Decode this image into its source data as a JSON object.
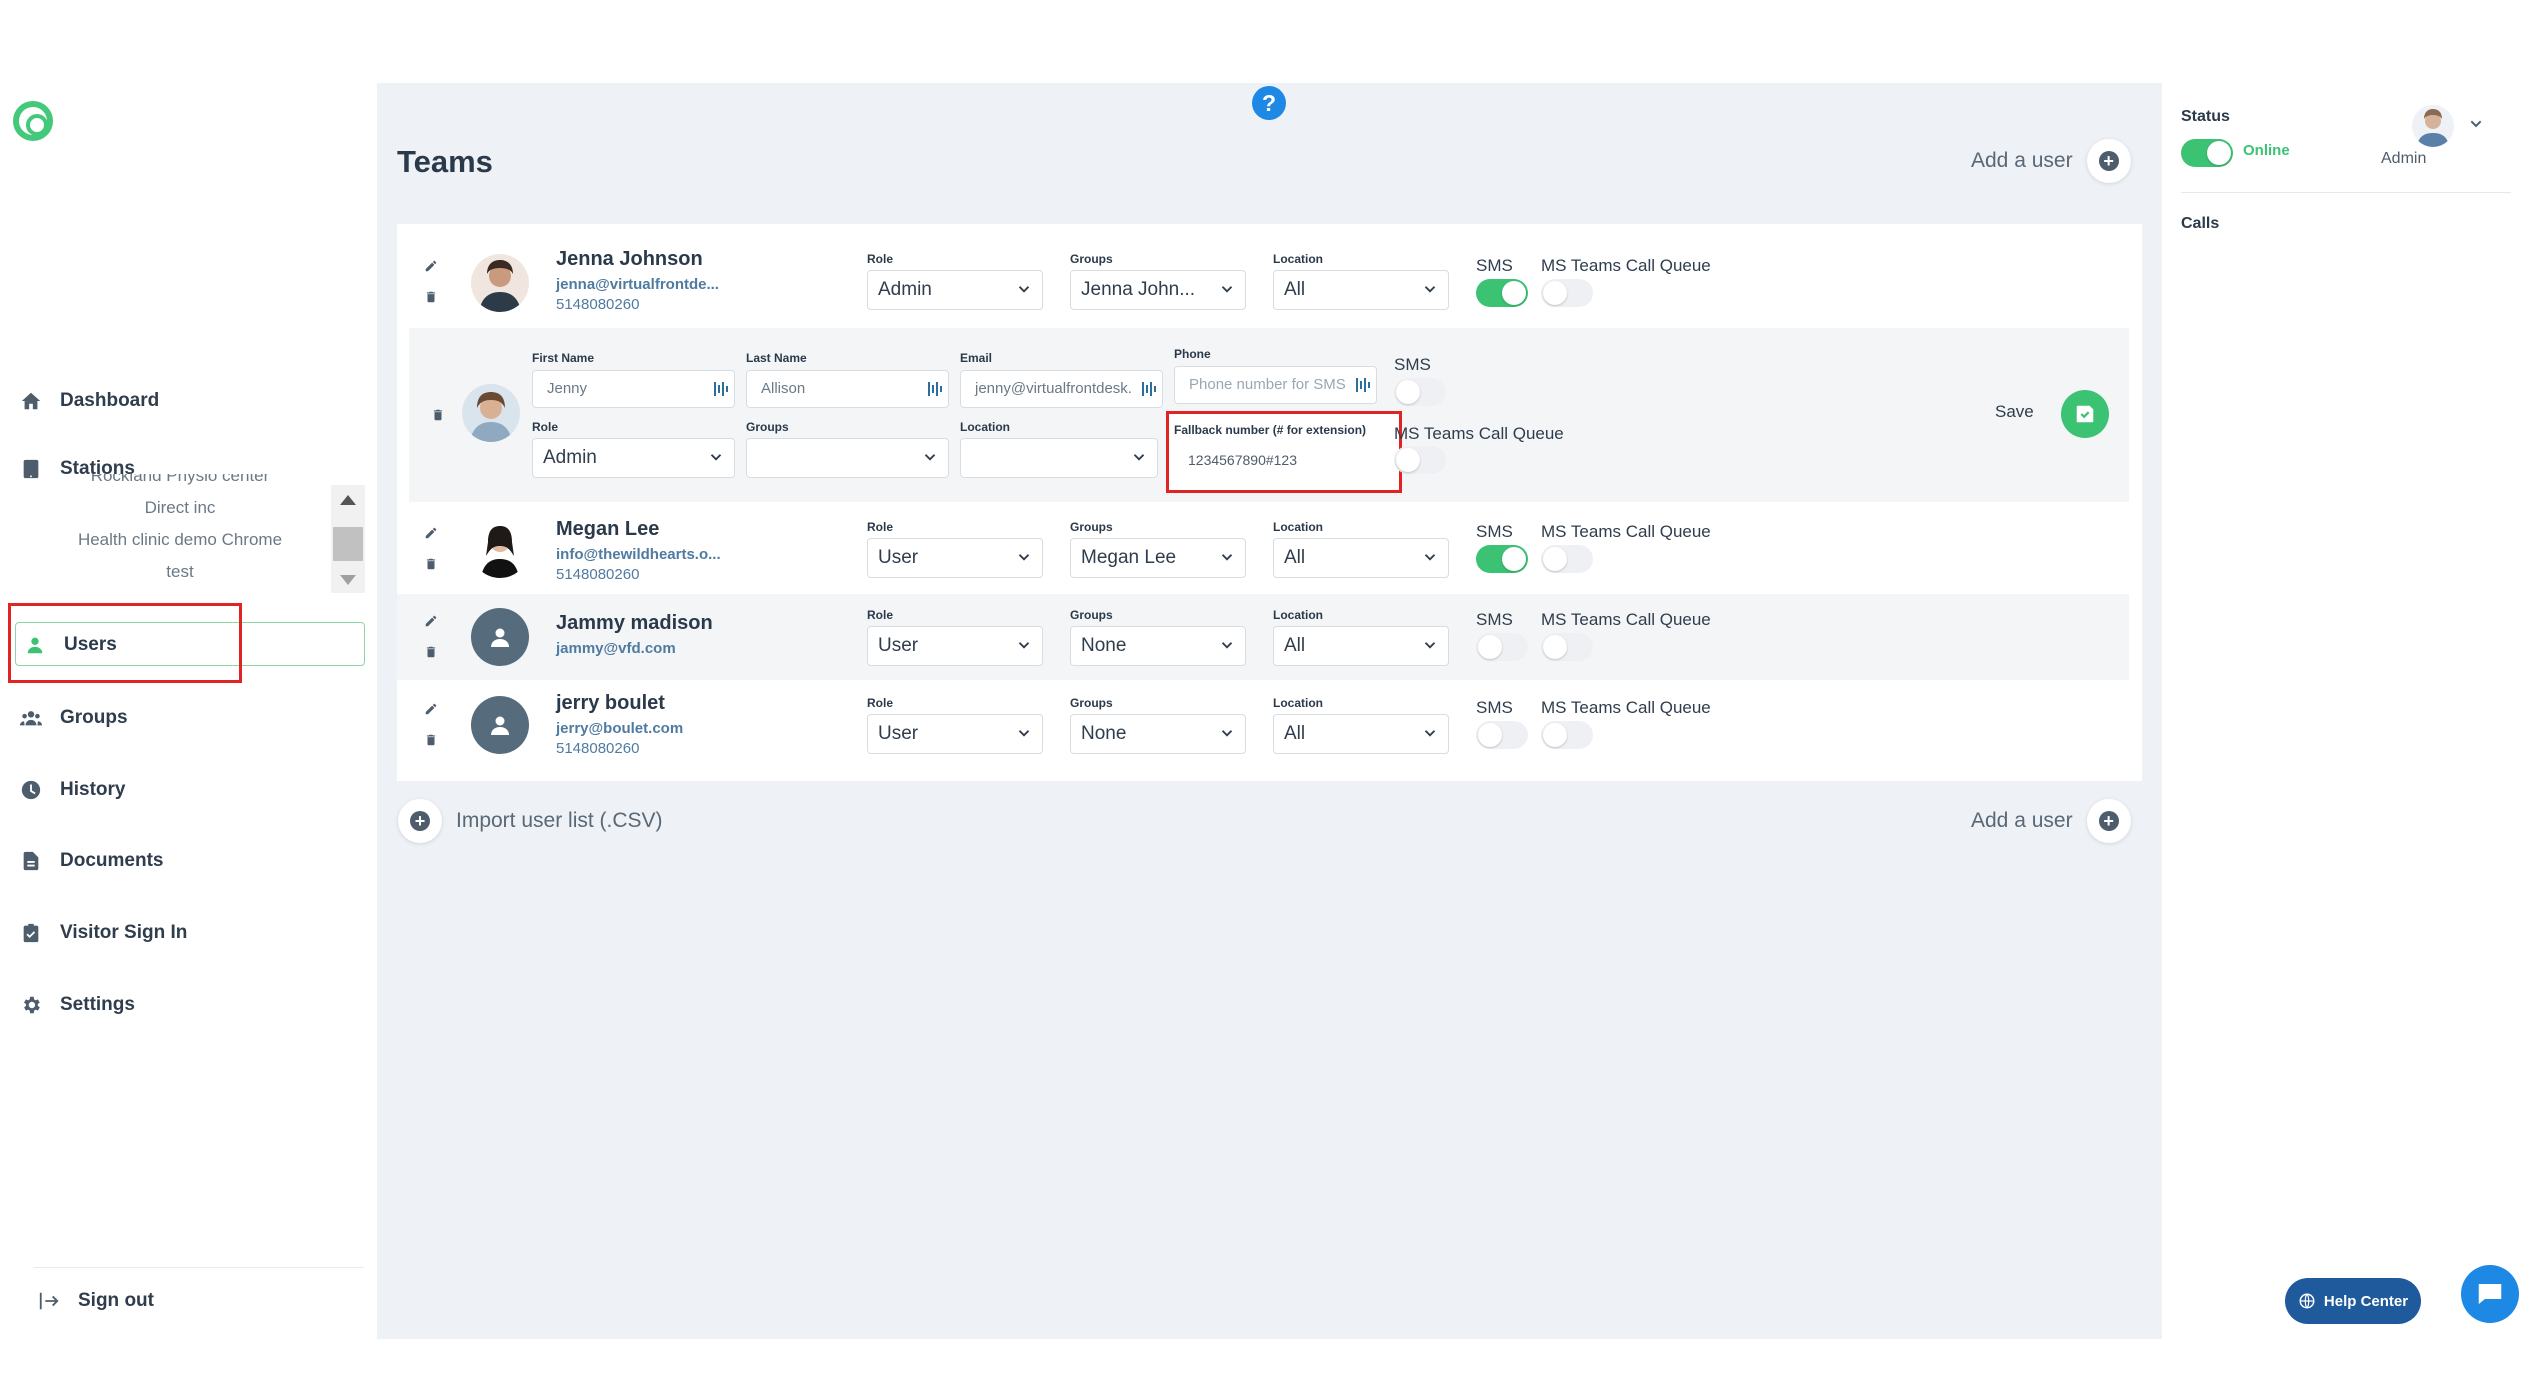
{
  "sidebar": {
    "nav": {
      "dashboard": "Dashboard",
      "stations": "Stations",
      "users": "Users",
      "groups": "Groups",
      "history": "History",
      "documents": "Documents",
      "visitor_sign_in": "Visitor Sign In",
      "settings": "Settings",
      "sign_out": "Sign out"
    },
    "stations": [
      "Rockland Physio center",
      "Direct inc",
      "Health clinic demo Chrome",
      "test"
    ]
  },
  "main": {
    "title": "Teams",
    "add_user": "Add a user",
    "import_csv": "Import user list (.CSV)",
    "labels": {
      "role": "Role",
      "groups": "Groups",
      "location": "Location",
      "sms": "SMS",
      "ms_teams": "MS Teams Call Queue"
    },
    "users": [
      {
        "name": "Jenna Johnson",
        "email": "jenna@virtualfrontde...",
        "phone": "5148080260",
        "role": "Admin",
        "group": "Jenna John...",
        "location": "All",
        "sms_on": true,
        "teams_on": false
      },
      {
        "name": "Megan Lee",
        "email": "info@thewildhearts.o...",
        "phone": "5148080260",
        "role": "User",
        "group": "Megan Lee",
        "location": "All",
        "sms_on": true,
        "teams_on": false
      },
      {
        "name": "Jammy madison",
        "email": "jammy@vfd.com",
        "phone": "",
        "role": "User",
        "group": "None",
        "location": "All",
        "sms_on": false,
        "teams_on": false
      },
      {
        "name": "jerry boulet",
        "email": "jerry@boulet.com",
        "phone": "5148080260",
        "role": "User",
        "group": "None",
        "location": "All",
        "sms_on": false,
        "teams_on": false
      }
    ],
    "edit_form": {
      "first_name_label": "First Name",
      "first_name": "Jenny",
      "last_name_label": "Last Name",
      "last_name": "Allison",
      "email_label": "Email",
      "email": "jenny@virtualfrontdesk.",
      "phone_label": "Phone",
      "phone_placeholder": "Phone number for SMS",
      "sms_label": "SMS",
      "role_label": "Role",
      "role": "Admin",
      "groups_label": "Groups",
      "location_label": "Location",
      "fallback_label": "Fallback number (# for extension)",
      "fallback_value": "1234567890#123",
      "ms_teams_label": "MS Teams Call Queue",
      "save": "Save"
    }
  },
  "right_panel": {
    "status_label": "Status",
    "status_value": "Online",
    "user_role": "Admin",
    "calls_label": "Calls"
  },
  "help_center": "Help Center",
  "colors": {
    "accent": "#3cc273",
    "help_blue": "#1e88e5",
    "highlight": "#e02424"
  }
}
